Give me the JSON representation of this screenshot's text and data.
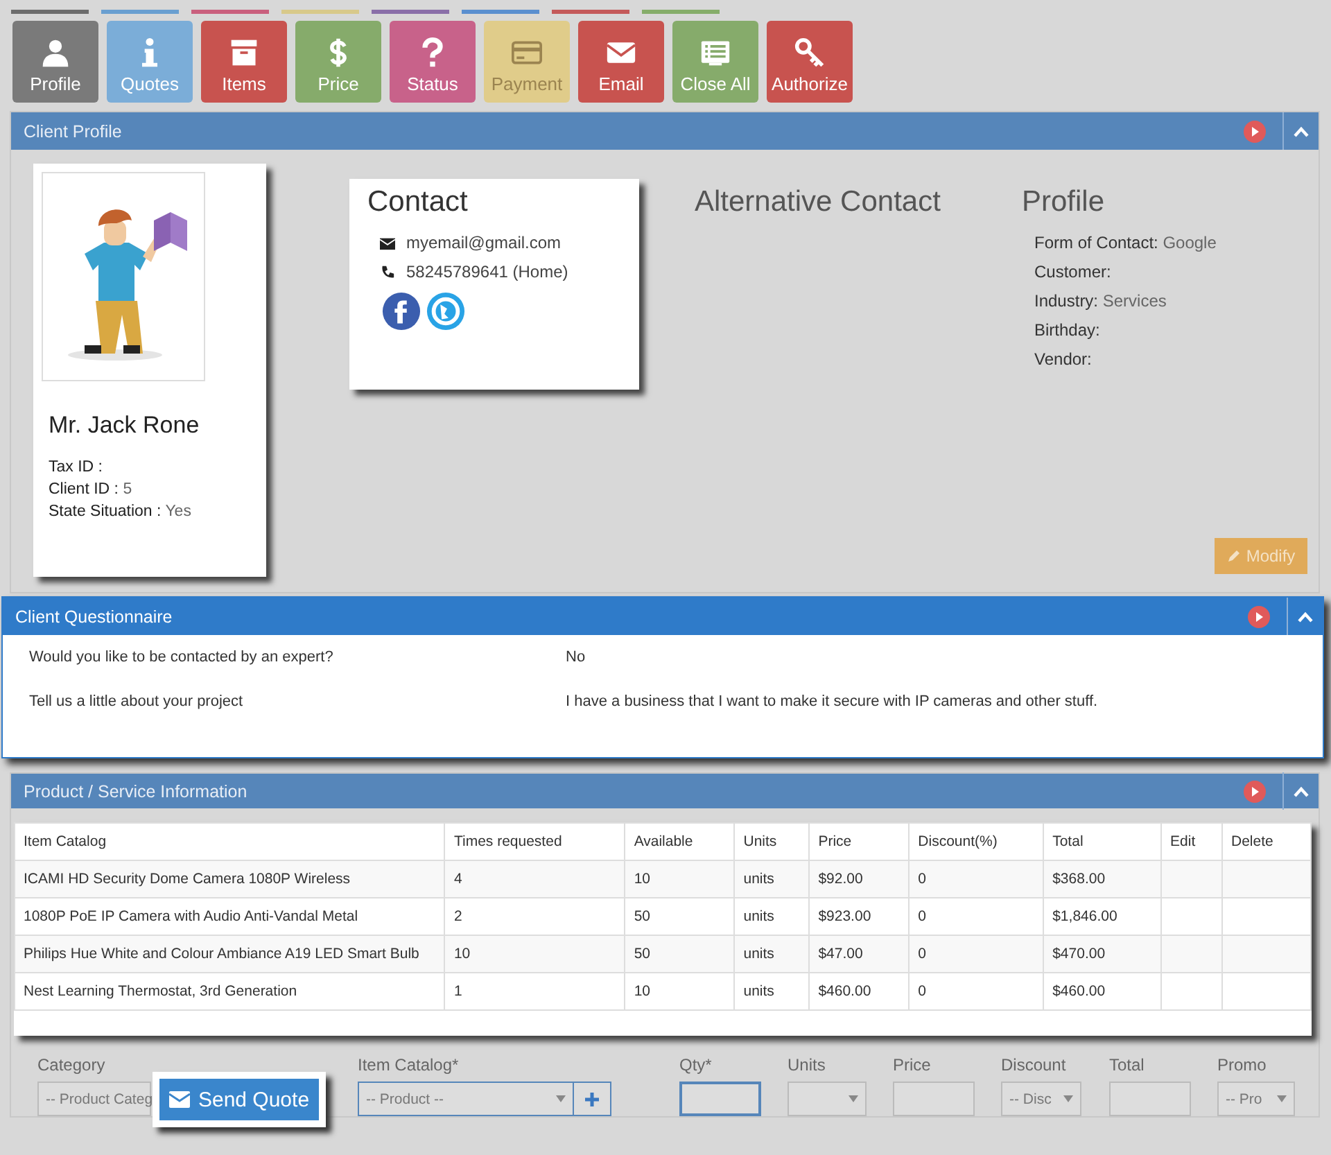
{
  "top_strips": [
    {
      "color": "#6d6d6d"
    },
    {
      "color": "#6a9fd0"
    },
    {
      "color": "#c9607e"
    },
    {
      "color": "#d8c98a"
    },
    {
      "color": "#8a6fa8"
    },
    {
      "color": "#5a8fcf"
    },
    {
      "color": "#c45a5a"
    },
    {
      "color": "#86ad6a"
    }
  ],
  "toolbar": [
    {
      "label": "Profile",
      "kind": "user",
      "color": "#7a7a7a"
    },
    {
      "label": "Quotes",
      "kind": "info",
      "color": "#7badd8"
    },
    {
      "label": "Items",
      "kind": "box",
      "color": "#c8534f"
    },
    {
      "label": "Price",
      "kind": "dollar",
      "color": "#86ab6b"
    },
    {
      "label": "Status",
      "kind": "question",
      "color": "#c8628a"
    },
    {
      "label": "Payment",
      "kind": "card",
      "color": "#e0cc8a"
    },
    {
      "label": "Email",
      "kind": "envelope",
      "color": "#c8534f"
    },
    {
      "label": "Close All",
      "kind": "list",
      "color": "#86ab6b"
    },
    {
      "label": "Authorize",
      "kind": "key",
      "color": "#c8534f"
    }
  ],
  "client_profile": {
    "title": "Client Profile",
    "person": {
      "name": "Mr. Jack Rone",
      "fields": [
        {
          "label": "Tax ID :"
        },
        {
          "label": "Client ID :",
          "value": "5"
        },
        {
          "label": "State Situation :",
          "value": "Yes"
        }
      ]
    },
    "contact": {
      "title": "Contact",
      "email": "myemail@gmail.com",
      "phone": "58245789641 (Home)"
    },
    "alternative_contact": {
      "title": "Alternative Contact"
    },
    "profile": {
      "title": "Profile",
      "fields": [
        {
          "label": "Form of Contact:",
          "value": "Google"
        },
        {
          "label": "Customer:"
        },
        {
          "label": "Industry:",
          "value": "Services"
        },
        {
          "label": "Birthday:"
        },
        {
          "label": "Vendor:"
        }
      ]
    },
    "modify_button": "Modify"
  },
  "questionnaire": {
    "title": "Client Questionnaire",
    "rows": [
      {
        "question": "Would you like to be contacted by an expert?",
        "answer": "No"
      },
      {
        "question": "Tell us a little about your project",
        "answer": "I have a business that I want to make it secure with IP cameras and other stuff."
      }
    ]
  },
  "products": {
    "title": "Product / Service Information",
    "columns": [
      "Item Catalog",
      "Times requested",
      "Available",
      "Units",
      "Price",
      "Discount(%)",
      "Total",
      "Edit",
      "Delete"
    ],
    "rows": [
      [
        "ICAMI HD Security Dome Camera 1080P Wireless",
        "4",
        "10",
        "units",
        "$92.00",
        "0",
        "$368.00",
        "",
        ""
      ],
      [
        "1080P PoE IP Camera with Audio Anti-Vandal Metal",
        "2",
        "50",
        "units",
        "$923.00",
        "0",
        "$1,846.00",
        "",
        ""
      ],
      [
        "Philips Hue White and Colour Ambiance A19 LED Smart Bulb",
        "10",
        "50",
        "units",
        "$47.00",
        "0",
        "$470.00",
        "",
        ""
      ],
      [
        "Nest Learning Thermostat, 3rd Generation",
        "1",
        "10",
        "units",
        "$460.00",
        "0",
        "$460.00",
        "",
        ""
      ]
    ]
  },
  "form": {
    "fields": [
      {
        "label": "Category",
        "kind": "select",
        "value": "-- Product Categ"
      },
      {
        "label": "Item Catalog*",
        "kind": "select_add",
        "value": "-- Product --"
      },
      {
        "label": "Qty*",
        "kind": "input",
        "focused": true
      },
      {
        "label": "Units",
        "kind": "select"
      },
      {
        "label": "Price",
        "kind": "input",
        "focused": false
      },
      {
        "label": "Discount",
        "kind": "select",
        "value": "-- Disc"
      },
      {
        "label": "Total",
        "kind": "input",
        "focused": false
      },
      {
        "label": "Promo",
        "kind": "select",
        "value": "-- Pro"
      }
    ],
    "send_quote": "Send Quote"
  }
}
